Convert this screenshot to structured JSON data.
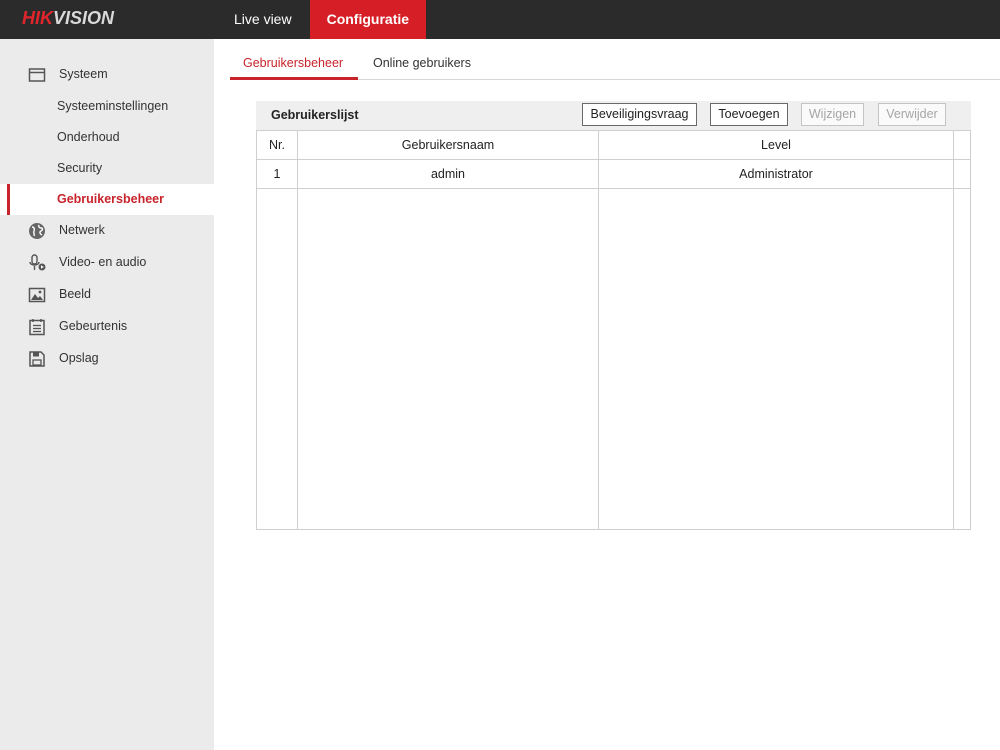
{
  "brand": {
    "logo_part1": "HIK",
    "logo_part2": "VISION",
    "accent_color": "#d51e26"
  },
  "topnav": [
    {
      "label": "Live view",
      "active": false
    },
    {
      "label": "Configuratie",
      "active": true
    }
  ],
  "sidebar": {
    "groups": [
      {
        "label": "Systeem",
        "icon": "window-icon"
      },
      {
        "label": "Netwerk",
        "icon": "globe-icon"
      },
      {
        "label": "Video- en audio",
        "icon": "microphone-icon"
      },
      {
        "label": "Beeld",
        "icon": "image-icon"
      },
      {
        "label": "Gebeurtenis",
        "icon": "calendar-icon"
      },
      {
        "label": "Opslag",
        "icon": "save-icon"
      }
    ],
    "system_items": [
      {
        "label": "Systeeminstellingen",
        "active": false
      },
      {
        "label": "Onderhoud",
        "active": false
      },
      {
        "label": "Security",
        "active": false
      },
      {
        "label": "Gebruikersbeheer",
        "active": true
      }
    ]
  },
  "tabs": [
    {
      "label": "Gebruikersbeheer",
      "active": true
    },
    {
      "label": "Online gebruikers",
      "active": false
    }
  ],
  "user_list": {
    "title": "Gebruikerslijst",
    "buttons": [
      {
        "label": "Beveiligingsvraag",
        "enabled": true
      },
      {
        "label": "Toevoegen",
        "enabled": true
      },
      {
        "label": "Wijzigen",
        "enabled": false
      },
      {
        "label": "Verwijder",
        "enabled": false
      }
    ],
    "columns": [
      "Nr.",
      "Gebruikersnaam",
      "Level"
    ],
    "rows": [
      {
        "nr": "1",
        "username": "admin",
        "level": "Administrator"
      }
    ]
  }
}
